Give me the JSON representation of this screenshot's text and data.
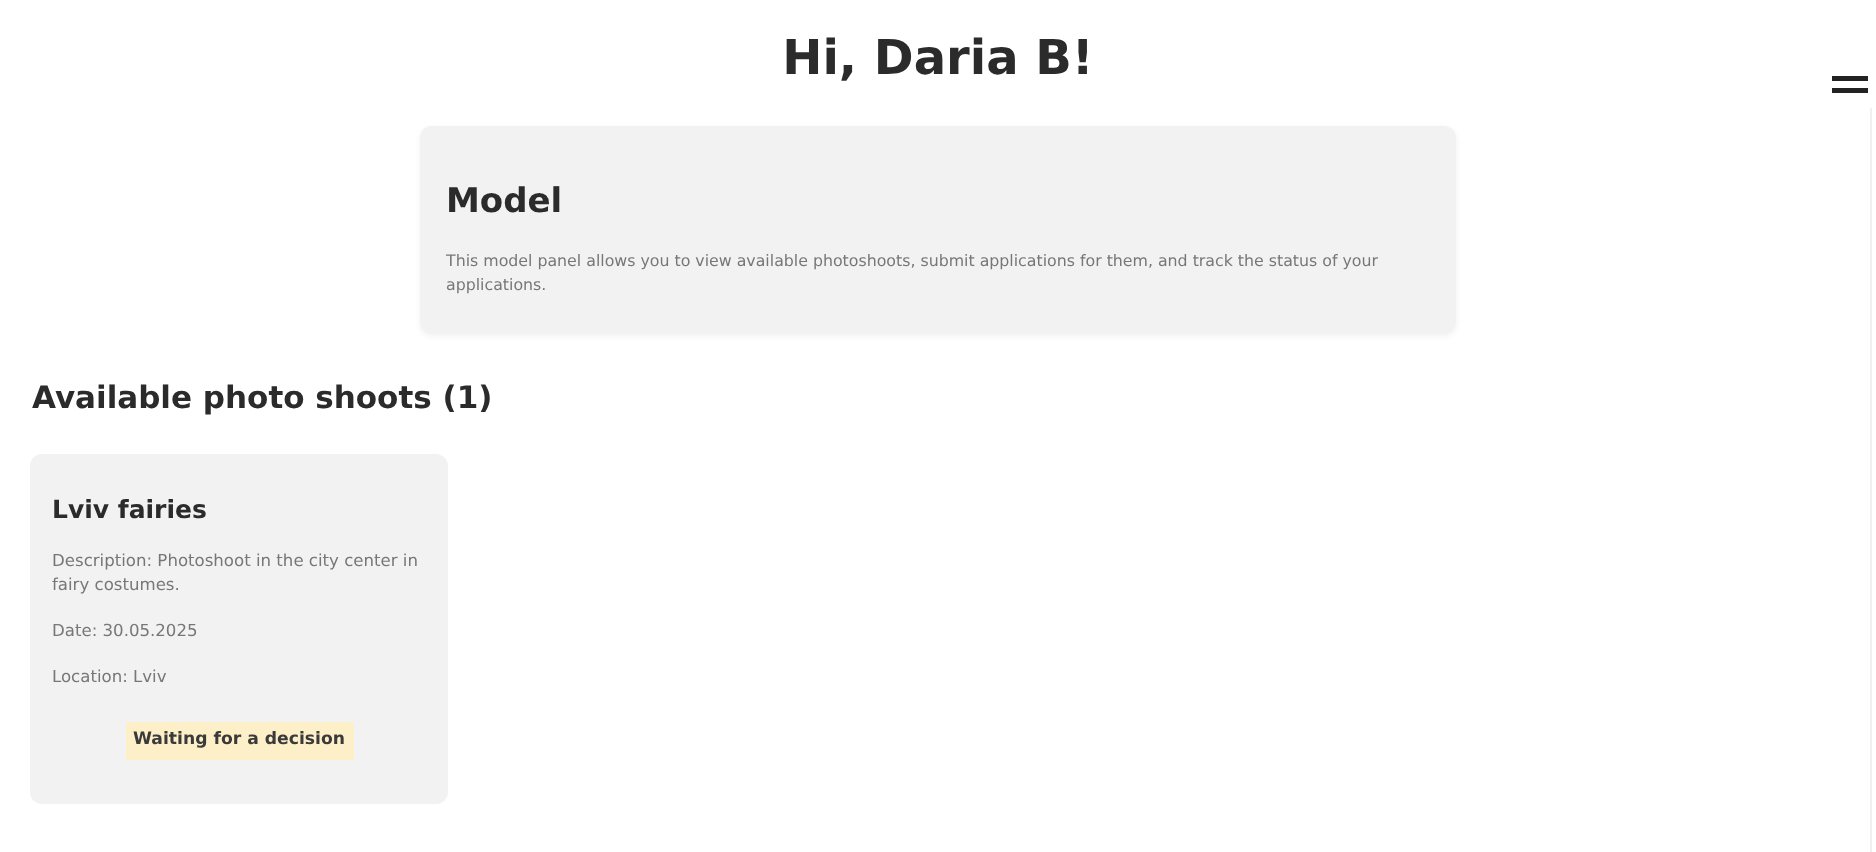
{
  "greeting": "Hi, Daria B!",
  "panel": {
    "title": "Model",
    "text": "This model panel allows you to view available photoshoots, submit applications for them, and track the status of your applications."
  },
  "section_title": "Available photo shoots (1)",
  "shoots": [
    {
      "title": "Lviv fairies",
      "description": "Description: Photoshoot in the city center in fairy costumes.",
      "date": "Date: 30.05.2025",
      "location": "Location: Lviv",
      "status": {
        "kind": "pending",
        "label": "Waiting for a decision"
      }
    }
  ]
}
